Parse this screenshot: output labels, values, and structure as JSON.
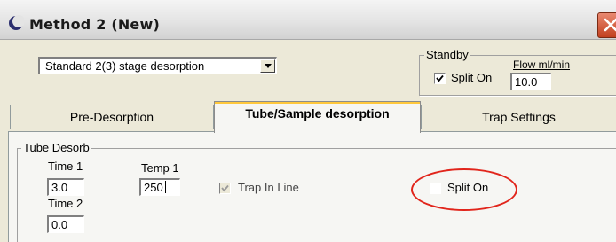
{
  "window": {
    "title": "Method  2 (New)",
    "icon": "moon-app-icon",
    "close_icon": "close-x-icon"
  },
  "method_select": {
    "value": "Standard 2(3) stage desorption",
    "icon": "dropdown-arrow-icon"
  },
  "standby": {
    "legend": "Standby",
    "split_on_label": "Split On",
    "split_on_checked": true,
    "flow_label": "Flow  ml/min",
    "flow_value": "10.0"
  },
  "tabs": [
    {
      "label": "Pre-Desorption",
      "active": false
    },
    {
      "label": "Tube/Sample desorption",
      "active": true
    },
    {
      "label": "Trap Settings",
      "active": false
    }
  ],
  "tube_desorb": {
    "legend": "Tube Desorb",
    "time1_label": "Time 1",
    "time1_value": "3.0",
    "temp1_label": "Temp 1",
    "temp1_value": "250",
    "time2_label": "Time 2",
    "time2_value": "0.0",
    "trap_in_line_label": "Trap In Line",
    "trap_in_line_checked": true,
    "trap_in_line_disabled": true,
    "split_on_label": "Split On",
    "split_on_checked": false
  },
  "colors": {
    "annotation": "#e1251b",
    "close_button": "#d4582f",
    "active_tab_accent": "#ffc83c"
  }
}
